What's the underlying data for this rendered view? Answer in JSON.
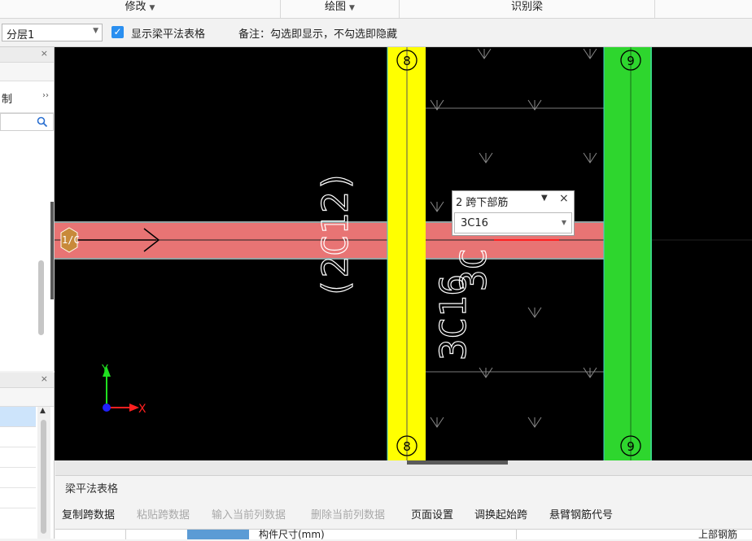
{
  "ribbon": {
    "groups": [
      {
        "label": "修改",
        "has_caret": true
      },
      {
        "label": "绘图",
        "has_caret": true
      },
      {
        "label": "识别梁",
        "has_caret": false
      }
    ]
  },
  "toolbar": {
    "floor_select": "分层1",
    "show_table_checked": true,
    "show_table_label": "显示梁平法表格",
    "remark": "备注：勾选即显示，不勾选即隐藏"
  },
  "left_panel": {
    "row_label": "制",
    "expand_glyph": "››"
  },
  "canvas": {
    "axis_labels": {
      "col8_top": "8",
      "col9_top": "9",
      "col8_bottom": "8",
      "col9_bottom": "9",
      "row_label": "1/C"
    },
    "beam_texts": {
      "left_vertical": "(2C12)",
      "right_partial": "3C",
      "right_vertical": "3C16"
    },
    "coord": {
      "x": "X",
      "y": "Y"
    },
    "colors": {
      "yellow_column": "#ffff00",
      "green_column": "#2ed62e",
      "beam": "#e87474",
      "background": "#000000"
    }
  },
  "popup": {
    "title": "2 跨下部筋",
    "value": "3C16"
  },
  "bottom_panel": {
    "title": "梁平法表格",
    "buttons": [
      {
        "label": "复制跨数据",
        "enabled": true
      },
      {
        "label": "粘贴跨数据",
        "enabled": false
      },
      {
        "label": "输入当前列数据",
        "enabled": false
      },
      {
        "label": "删除当前列数据",
        "enabled": false
      },
      {
        "label": "页面设置",
        "enabled": true
      },
      {
        "label": "调换起始跨",
        "enabled": true
      },
      {
        "label": "悬臂钢筋代号",
        "enabled": true
      }
    ],
    "grid_headers": {
      "size": "构件尺寸(mm)",
      "top_rebar": "上部钢筋"
    }
  }
}
